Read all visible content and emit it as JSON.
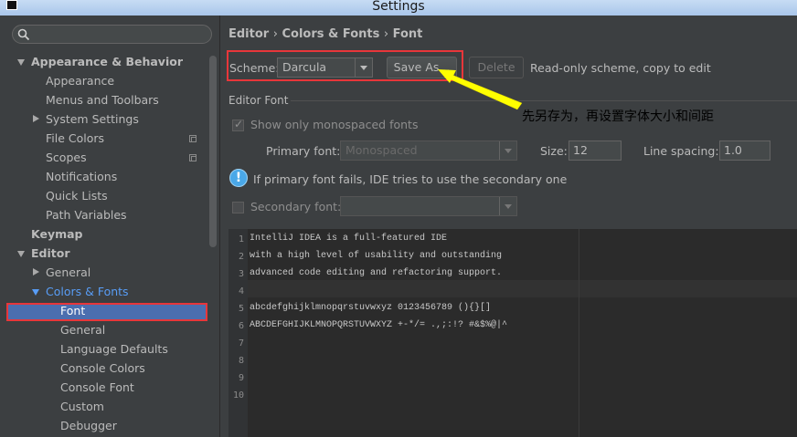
{
  "window": {
    "title": "Settings"
  },
  "search": {
    "placeholder": ""
  },
  "sidebar": {
    "items": [
      {
        "label": "Appearance & Behavior"
      },
      {
        "label": "Appearance"
      },
      {
        "label": "Menus and Toolbars"
      },
      {
        "label": "System Settings"
      },
      {
        "label": "File Colors"
      },
      {
        "label": "Scopes"
      },
      {
        "label": "Notifications"
      },
      {
        "label": "Quick Lists"
      },
      {
        "label": "Path Variables"
      },
      {
        "label": "Keymap"
      },
      {
        "label": "Editor"
      },
      {
        "label": "General"
      },
      {
        "label": "Colors & Fonts"
      },
      {
        "label": "Font"
      },
      {
        "label": "General"
      },
      {
        "label": "Language Defaults"
      },
      {
        "label": "Console Colors"
      },
      {
        "label": "Console Font"
      },
      {
        "label": "Custom"
      },
      {
        "label": "Debugger"
      }
    ]
  },
  "breadcrumb": {
    "parts": [
      "Editor",
      "Colors & Fonts",
      "Font"
    ],
    "separator": "›"
  },
  "scheme": {
    "label": "Scheme:",
    "value": "Darcula",
    "save_as": "Save As...",
    "delete": "Delete",
    "readonly_note": "Read-only scheme, copy to edit"
  },
  "editor_font": {
    "section_title": "Editor Font",
    "monospaced_only": "Show only monospaced fonts",
    "primary_label": "Primary font:",
    "primary_value": "Monospaced",
    "size_label": "Size:",
    "size_value": "12",
    "spacing_label": "Line spacing:",
    "spacing_value": "1.0",
    "info_text": "If primary font fails, IDE tries to use the secondary one",
    "secondary_label": "Secondary font:"
  },
  "preview": {
    "line_numbers": [
      "1",
      "2",
      "3",
      "4",
      "5",
      "6",
      "7",
      "8",
      "9",
      "10"
    ],
    "lines": [
      "IntelliJ IDEA is a full-featured IDE",
      "with a high level of usability and outstanding",
      "advanced code editing and refactoring support.",
      "",
      "abcdefghijklmnopqrstuvwxyz 0123456789 (){}[]",
      "ABCDEFGHIJKLMNOPQRSTUVWXYZ +-*/= .,;:!? #&$%@|^"
    ]
  },
  "annotation": {
    "text": "先另存为，再设置字体大小和间距"
  },
  "colors": {
    "background": "#3c3f41",
    "editor_background": "#2b2b2b",
    "selection": "#4b6eaf",
    "link_blue": "#589df6",
    "highlight_border": "#e8363a",
    "annotation_arrow": "#ffff00"
  }
}
